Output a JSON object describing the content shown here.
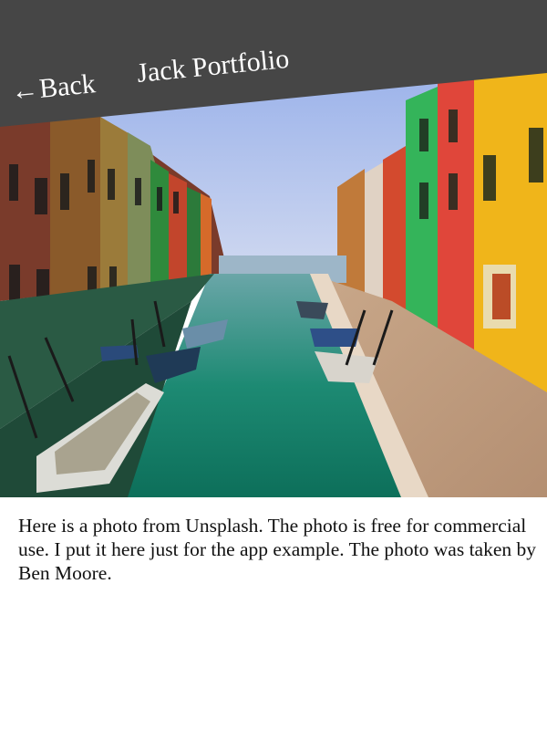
{
  "header": {
    "back_label": "Back",
    "back_arrow": "←",
    "title": "Jack Portfolio",
    "background": "#464646"
  },
  "photo": {
    "description_icon": "venice-canal-photo"
  },
  "caption": {
    "text": "Here is a photo from Unsplash. The photo is free for commercial use. I put it here just for the app example. The photo was taken by Ben Moore."
  }
}
